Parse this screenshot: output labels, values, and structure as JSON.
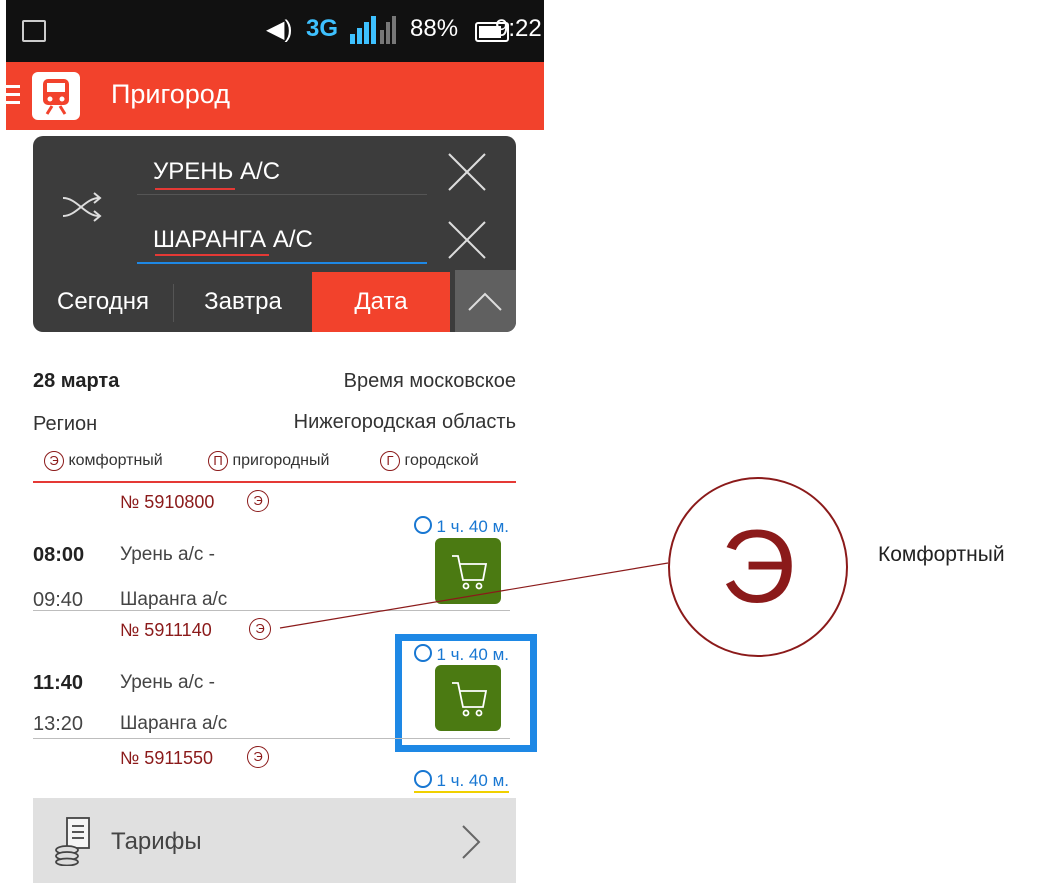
{
  "status_bar": {
    "network": "3G",
    "battery": "88%",
    "time": "9:22"
  },
  "app": {
    "title": "Пригород"
  },
  "search": {
    "from_value": "УРЕНЬ А/С",
    "to_value": "ШАРАНГА А/С"
  },
  "date_tabs": [
    {
      "label": "Сегодня",
      "active": false
    },
    {
      "label": "Завтра",
      "active": false
    },
    {
      "label": "Дата",
      "active": true
    }
  ],
  "info": {
    "date": "28 марта",
    "time_note": "Время московское",
    "region_label": "Регион",
    "region_value": "Нижегородская область"
  },
  "legend": [
    {
      "symbol": "Э",
      "label": "комфортный"
    },
    {
      "symbol": "П",
      "label": "пригородный"
    },
    {
      "symbol": "Г",
      "label": "городской"
    }
  ],
  "trains": [
    {
      "number": "№ 5910800",
      "class_symbol": "Э",
      "duration": "1 ч. 40 м.",
      "dep_time": "08:00",
      "dep_station": "Урень а/с -",
      "arr_time": "09:40",
      "arr_station": "Шаранга а/с"
    },
    {
      "number": "№ 5911140",
      "class_symbol": "Э",
      "duration": "1 ч. 40 м.",
      "dep_time": "11:40",
      "dep_station": "Урень а/с -",
      "arr_time": "13:20",
      "arr_station": "Шаранга а/с"
    },
    {
      "number": "№ 5911550",
      "class_symbol": "Э",
      "duration": "1 ч. 40 м."
    }
  ],
  "tariffs": {
    "label": "Тарифы"
  },
  "callout": {
    "symbol": "Э",
    "label": "Комфортный"
  },
  "colors": {
    "accent": "#f2422c",
    "panel": "#3c3c3c",
    "cart": "#4b7a12",
    "highlight": "#1e88e5",
    "callout": "#8b1a1a"
  }
}
